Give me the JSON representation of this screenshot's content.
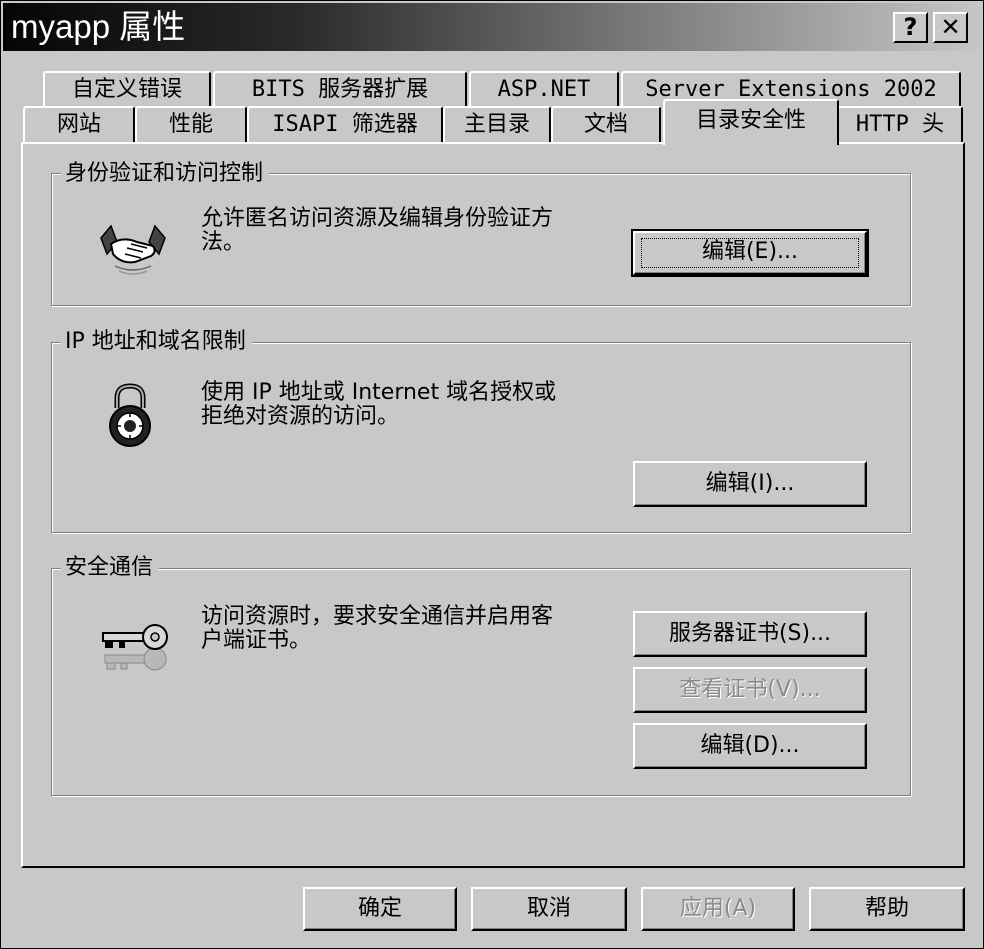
{
  "window": {
    "title": "myapp 属性",
    "help_glyph": "?",
    "close_glyph": "✕"
  },
  "tabs": {
    "row1": [
      {
        "label": "自定义错误"
      },
      {
        "label": "BITS 服务器扩展"
      },
      {
        "label": "ASP.NET"
      },
      {
        "label": "Server Extensions 2002"
      }
    ],
    "row2": [
      {
        "label": "网站"
      },
      {
        "label": "性能"
      },
      {
        "label": "ISAPI 筛选器"
      },
      {
        "label": "主目录"
      },
      {
        "label": "文档"
      },
      {
        "label": "目录安全性",
        "active": true
      },
      {
        "label": "HTTP 头"
      }
    ]
  },
  "groups": {
    "auth": {
      "title": "身份验证和访问控制",
      "description_line1": "允许匿名访问资源及编辑身份验证方",
      "description_line2": "法。",
      "edit_button": "编辑(E)...",
      "icon": "handshake-icon"
    },
    "ip": {
      "title": "IP 地址和域名限制",
      "description_line1": "使用 IP 地址或 Internet 域名授权或",
      "description_line2": "拒绝对资源的访问。",
      "edit_button": "编辑(I)...",
      "icon": "padlock-icon"
    },
    "secure": {
      "title": "安全通信",
      "description_line1": "访问资源时，要求安全通信并启用客",
      "description_line2": "户端证书。",
      "server_cert_button": "服务器证书(S)...",
      "view_cert_button": "查看证书(V)...",
      "edit_button": "编辑(D)...",
      "icon": "key-icon"
    }
  },
  "footer": {
    "ok": "确定",
    "cancel": "取消",
    "apply": "应用(A)",
    "help": "帮助"
  }
}
